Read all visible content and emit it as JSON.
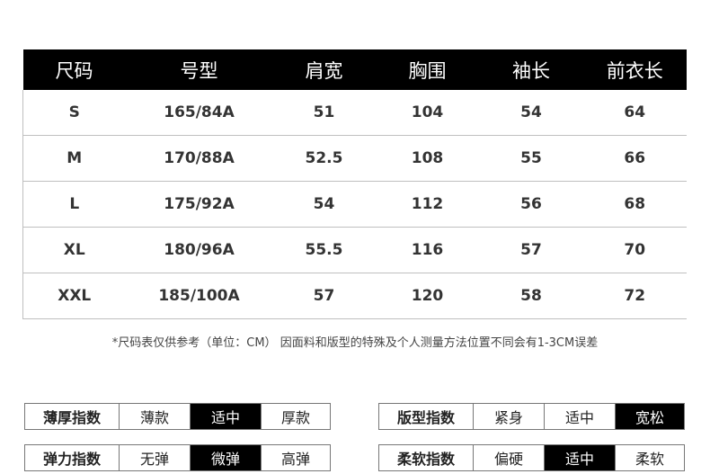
{
  "table": {
    "headers": [
      "尺码",
      "号型",
      "肩宽",
      "胸围",
      "袖长",
      "前衣长"
    ],
    "rows": [
      [
        "S",
        "165/84A",
        "51",
        "104",
        "54",
        "64"
      ],
      [
        "M",
        "170/88A",
        "52.5",
        "108",
        "55",
        "66"
      ],
      [
        "L",
        "175/92A",
        "54",
        "112",
        "56",
        "68"
      ],
      [
        "XL",
        "180/96A",
        "55.5",
        "116",
        "57",
        "70"
      ],
      [
        "XXL",
        "185/100A",
        "57",
        "120",
        "58",
        "72"
      ]
    ]
  },
  "note": "*尺码表仅供参考（单位：CM） 因面料和版型的特殊及个人测量方法位置不同会有1-3CM误差",
  "indices": {
    "thickness": {
      "label": "薄厚指数",
      "options": [
        "薄款",
        "适中",
        "厚款"
      ],
      "selected": "适中"
    },
    "fit": {
      "label": "版型指数",
      "options": [
        "紧身",
        "适中",
        "宽松"
      ],
      "selected": "宽松"
    },
    "elasticity": {
      "label": "弹力指数",
      "options": [
        "无弹",
        "微弹",
        "高弹"
      ],
      "selected": "微弹"
    },
    "softness": {
      "label": "柔软指数",
      "options": [
        "偏硬",
        "适中",
        "柔软"
      ],
      "selected": "适中"
    }
  }
}
